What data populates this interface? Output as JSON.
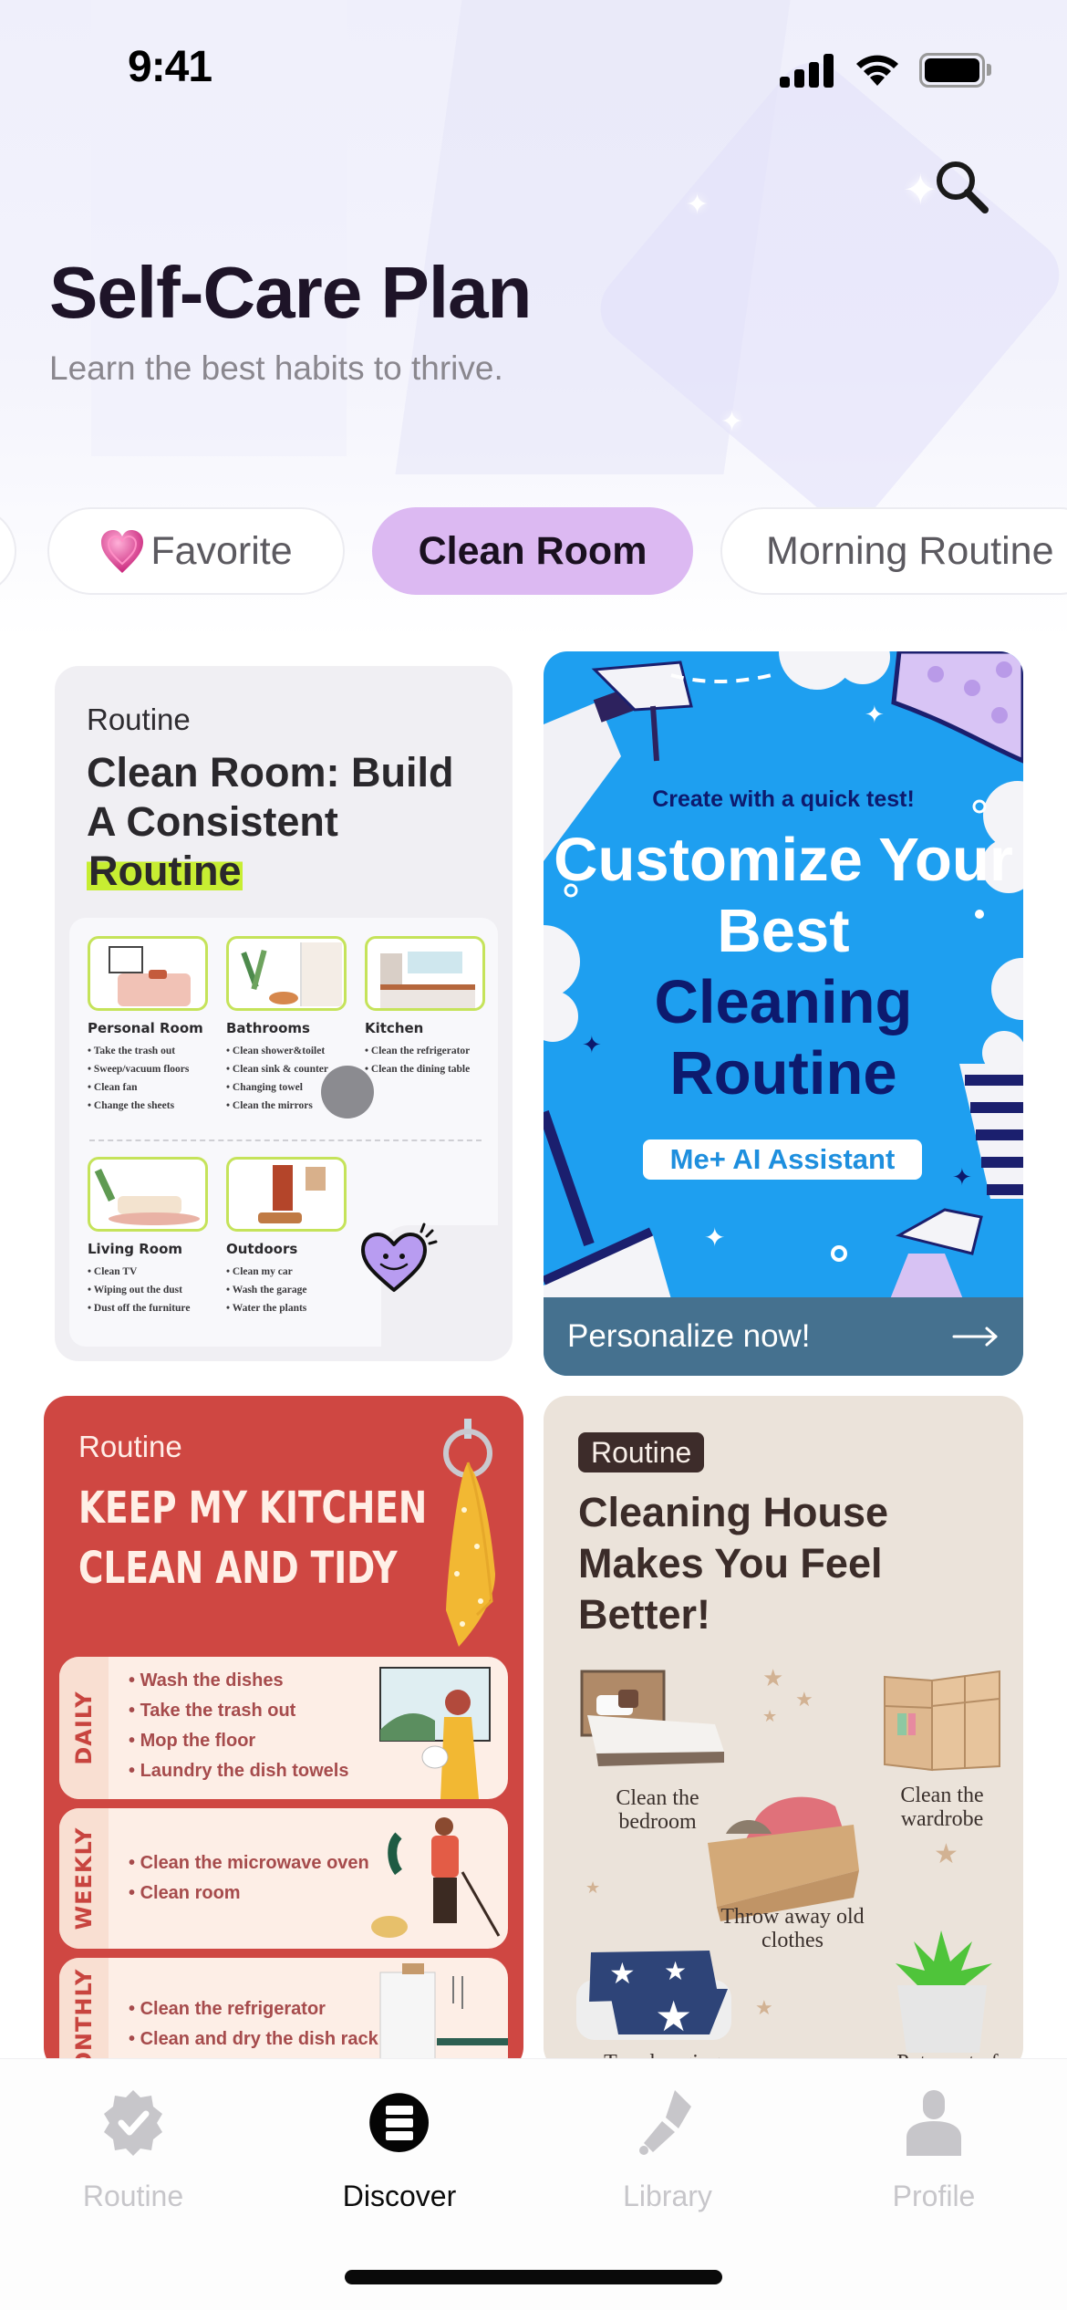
{
  "status_bar": {
    "time": "9:41",
    "icons": [
      "cellular-signal-icon",
      "wifi-icon",
      "battery-icon"
    ]
  },
  "header": {
    "title": "Self-Care Plan",
    "subtitle": "Learn the best habits to thrive.",
    "search_icon": "search-icon"
  },
  "categories": {
    "items": [
      {
        "label": "",
        "active": false,
        "partial": true
      },
      {
        "label": "Favorite",
        "icon": "pink-heart-emoji",
        "active": false
      },
      {
        "label": "Clean Room",
        "active": true
      },
      {
        "label": "Morning Routine",
        "active": false,
        "partial": true
      }
    ]
  },
  "cards": {
    "clean_room": {
      "tag": "Routine",
      "title_part1": "Clean Room: Build A Consistent ",
      "title_highlight": "Routine",
      "rooms": [
        {
          "name": "Personal Room",
          "tasks": [
            "Take the trash out",
            "Sweep/vacuum floors",
            "Clean fan",
            "Change the sheets"
          ]
        },
        {
          "name": "Bathrooms",
          "tasks": [
            "Clean shower&toilet",
            "Clean sink & counter",
            "Changing towel",
            "Clean the mirrors"
          ]
        },
        {
          "name": "Kitchen",
          "tasks": [
            "Clean the refrigerator",
            "Clean the dining table"
          ]
        },
        {
          "name": "Living Room",
          "tasks": [
            "Clean TV",
            "Wiping out the dust",
            "Dust off the furniture"
          ]
        },
        {
          "name": "Outdoors",
          "tasks": [
            "Clean my car",
            "Wash the garage",
            "Water the plants"
          ]
        }
      ],
      "mascot_icon": "smiling-heart-icon"
    },
    "customize": {
      "subtitle": "Create with a quick test!",
      "headline_white": "Customize Your Best",
      "headline_navy": "Cleaning Routine",
      "pill": "Me+ AI Assistant",
      "cta_label": "Personalize now!",
      "cta_icon": "arrow-right-icon"
    },
    "kitchen": {
      "tag": "Routine",
      "title_line1": "KEEP MY KITCHEN",
      "title_line2": "CLEAN AND TIDY",
      "sections": [
        {
          "label": "DAILY",
          "tasks": [
            "Wash the dishes",
            "Take the trash out",
            "Mop the floor",
            "Laundry the dish towels"
          ]
        },
        {
          "label": "WEEKLY",
          "tasks": [
            "Clean the microwave oven",
            "Clean room"
          ]
        },
        {
          "label": "MONTHLY",
          "tasks": [
            "Clean the refrigerator",
            "Clean and dry the dish rack"
          ]
        }
      ]
    },
    "house": {
      "tag": "Routine",
      "title": "Cleaning House Makes You Feel Better!",
      "items": [
        {
          "label": "Clean the bedroom"
        },
        {
          "label": "Clean the wardrobe"
        },
        {
          "label": "Throw away old clothes"
        },
        {
          "label": "Try changing"
        },
        {
          "label": "Put a pot of"
        }
      ]
    }
  },
  "tab_bar": {
    "tabs": [
      {
        "label": "Routine",
        "icon": "verified-badge-icon",
        "active": false
      },
      {
        "label": "Discover",
        "icon": "discover-stack-icon",
        "active": true
      },
      {
        "label": "Library",
        "icon": "paintbrush-icon",
        "active": false
      },
      {
        "label": "Profile",
        "icon": "person-icon",
        "active": false
      }
    ]
  },
  "colors": {
    "accent_chip": "#dcb9f2",
    "highlight": "#c7ee32",
    "blue_card": "#1e9ff0",
    "navy": "#0d1a6e",
    "red_card": "#cf4742",
    "beige_card": "#ebe3da",
    "tab_inactive": "#c7c6ca"
  }
}
